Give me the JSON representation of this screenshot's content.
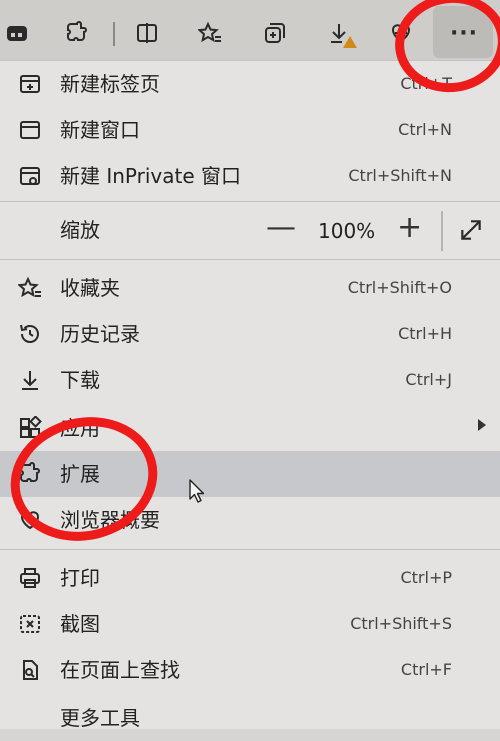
{
  "colors": {
    "toolbar_bg": "#cfcdca",
    "menu_bg": "#e5e3e1",
    "highlight_bg": "#c7c8cb",
    "annotation_red": "#ee1b1b",
    "warning": "#d18a1a"
  },
  "toolbar": {
    "icons": [
      "workspaces-icon",
      "extensions-icon",
      "split-screen-icon",
      "favorites-icon",
      "collections-icon",
      "downloads-icon",
      "browser-essentials-icon",
      "more-menu-icon"
    ],
    "more_label": "···"
  },
  "menu": {
    "new_tab": {
      "label": "新建标签页",
      "shortcut": "Ctrl+T"
    },
    "new_window": {
      "label": "新建窗口",
      "shortcut": "Ctrl+N"
    },
    "new_inprivate": {
      "label": "新建 InPrivate 窗口",
      "shortcut": "Ctrl+Shift+N"
    },
    "zoom": {
      "label": "缩放",
      "minus": "—",
      "value": "100%",
      "plus": "+"
    },
    "favorites": {
      "label": "收藏夹",
      "shortcut": "Ctrl+Shift+O"
    },
    "history": {
      "label": "历史记录",
      "shortcut": "Ctrl+H"
    },
    "downloads": {
      "label": "下载",
      "shortcut": "Ctrl+J"
    },
    "apps": {
      "label": "应用"
    },
    "extensions": {
      "label": "扩展"
    },
    "browser_essentials": {
      "label": "浏览器概要"
    },
    "print": {
      "label": "打印",
      "shortcut": "Ctrl+P"
    },
    "screenshot": {
      "label": "截图",
      "shortcut": "Ctrl+Shift+S"
    },
    "find": {
      "label": "在页面上查找",
      "shortcut": "Ctrl+F"
    },
    "more_tools": {
      "label": "更多工具"
    }
  }
}
